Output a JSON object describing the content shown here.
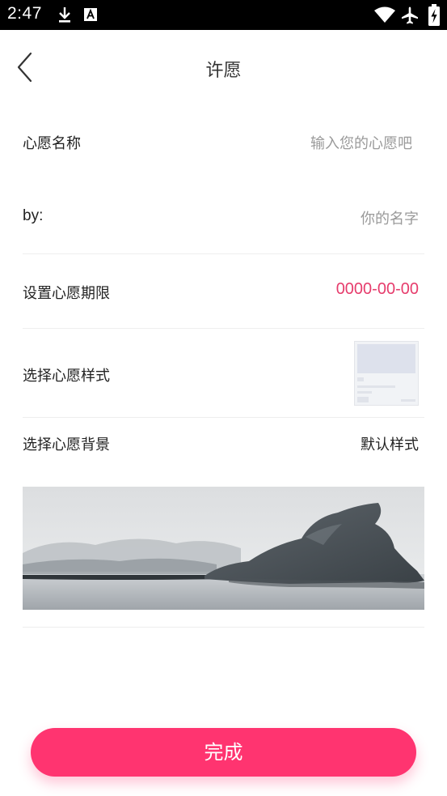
{
  "status_bar": {
    "time": "2:47",
    "icons": [
      "download-icon",
      "text-a-icon",
      "wifi-icon",
      "airplane-icon",
      "battery-charging-icon"
    ]
  },
  "header": {
    "title": "许愿",
    "back_icon": "chevron-left-icon"
  },
  "form": {
    "wish_name": {
      "label": "心愿名称",
      "placeholder": "输入您的心愿吧"
    },
    "by": {
      "label": "by:",
      "placeholder": "你的名字"
    },
    "deadline": {
      "label": "设置心愿期限",
      "value": "0000-00-00"
    },
    "style": {
      "label": "选择心愿样式"
    },
    "background": {
      "label": "选择心愿背景",
      "value": "默认样式"
    }
  },
  "done_button": {
    "label": "完成"
  },
  "colors": {
    "accent": "#ff3470",
    "date_text": "#e63c6c",
    "placeholder": "#9a9a9a",
    "divider": "#eeeeee"
  }
}
